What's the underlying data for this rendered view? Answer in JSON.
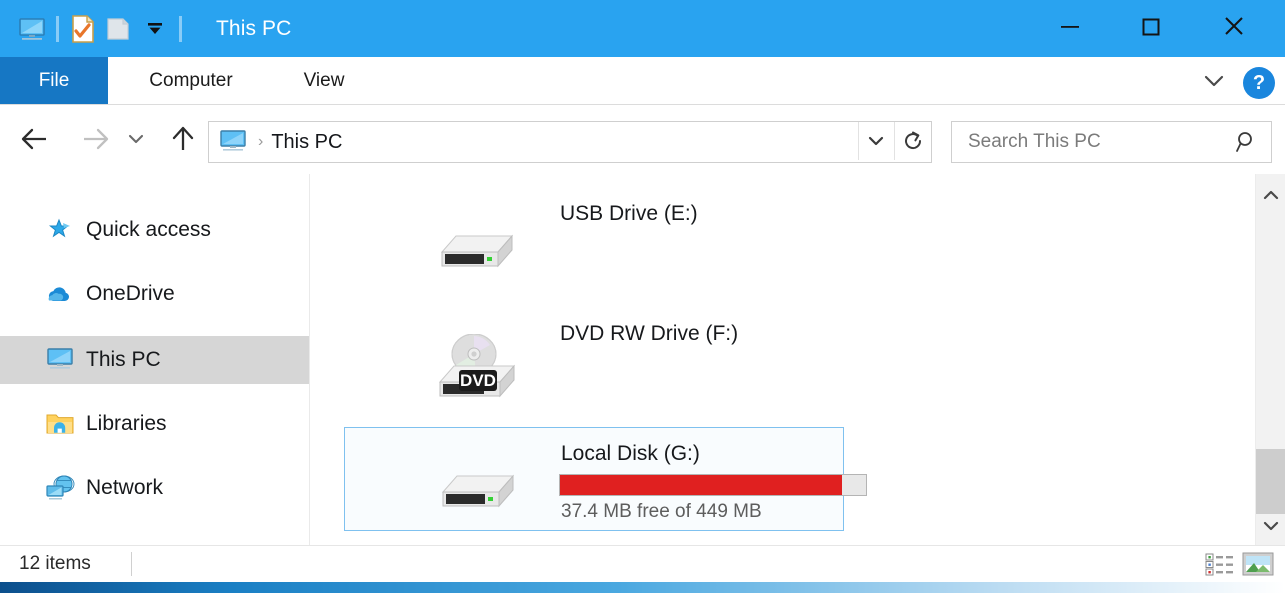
{
  "window": {
    "title": "This PC",
    "accent_color": "#29a3f0",
    "quick_access_toolbar": [
      {
        "name": "this-pc-icon",
        "label": "This PC"
      },
      {
        "name": "properties-icon",
        "label": "Properties"
      },
      {
        "name": "new-folder-icon",
        "label": "New folder"
      },
      {
        "name": "customize-dropdown-icon",
        "label": "Customize Quick Access Toolbar"
      }
    ],
    "controls": {
      "minimize": "—",
      "maximize": "☐",
      "close": "✕"
    }
  },
  "ribbon": {
    "tabs": [
      {
        "label": "File",
        "active": true
      },
      {
        "label": "Computer",
        "active": false
      },
      {
        "label": "View",
        "active": false
      }
    ],
    "expand_label": "⌄",
    "help_label": "?"
  },
  "address": {
    "back_label": "←",
    "forward_label": "→",
    "recent_label": "⌄",
    "up_label": "↑",
    "breadcrumb_icon": "this-pc-icon",
    "breadcrumb_separator": "›",
    "breadcrumb_label": "This PC",
    "dropdown_label": "⌄",
    "refresh_label": "↻"
  },
  "search": {
    "placeholder": "Search This PC",
    "value": "",
    "icon": "search-icon"
  },
  "sidebar": {
    "items": [
      {
        "label": "Quick access",
        "icon": "star-pin-icon",
        "selected": false
      },
      {
        "label": "OneDrive",
        "icon": "cloud-icon",
        "selected": false
      },
      {
        "label": "This PC",
        "icon": "monitor-icon",
        "selected": true
      },
      {
        "label": "Libraries",
        "icon": "libraries-folder-icon",
        "selected": false
      },
      {
        "label": "Network",
        "icon": "network-icon",
        "selected": false
      }
    ]
  },
  "content": {
    "drives": [
      {
        "name": "USB Drive (E:)",
        "icon": "usb-drive-icon",
        "selected": false,
        "has_bar": false,
        "sub": ""
      },
      {
        "name": "DVD RW Drive (F:)",
        "icon": "dvd-drive-icon",
        "badge": "DVD",
        "selected": false,
        "has_bar": false,
        "sub": ""
      },
      {
        "name": "Local Disk (G:)",
        "icon": "hard-drive-icon",
        "selected": true,
        "has_bar": true,
        "bar_fill_percent": 92,
        "bar_color": "#e02020",
        "sub": "37.4 MB free of 449 MB"
      }
    ]
  },
  "scrollbar": {
    "up_label": "⌃",
    "down_label": "⌄"
  },
  "status": {
    "item_count": "12 items",
    "view_details_label": "Details view",
    "view_icons_label": "Large icons view"
  }
}
